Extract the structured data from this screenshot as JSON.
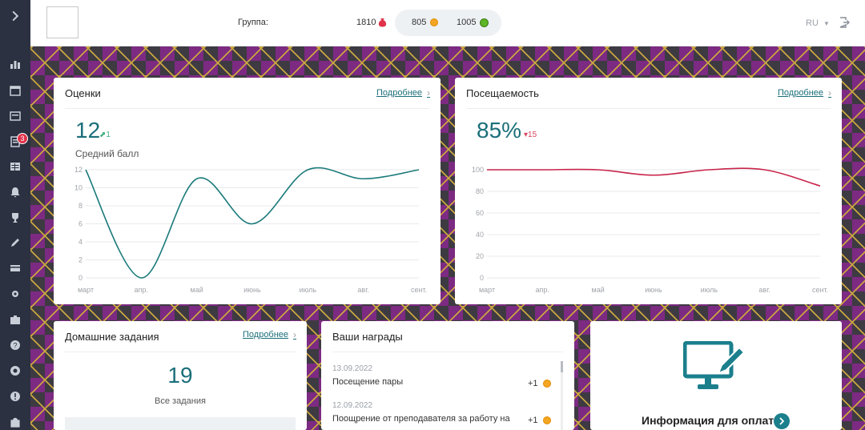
{
  "header": {
    "group_label": "Группа:",
    "money": "1810",
    "coins_orange": "805",
    "coins_green": "1005",
    "language": "RU"
  },
  "sidebar": {
    "badge_count": "3",
    "items": [
      "chart-icon",
      "calendar-icon",
      "book-icon",
      "homework-icon",
      "schedule-icon",
      "bell-icon",
      "trophy-icon",
      "pen-icon",
      "card-icon",
      "settings-icon",
      "briefcase-icon",
      "help-icon",
      "support-icon",
      "warning-icon",
      "shop-icon"
    ]
  },
  "grades": {
    "title": "Оценки",
    "details": "Подробнее",
    "value": "12",
    "delta": "1",
    "subtitle": "Средний балл"
  },
  "attendance": {
    "title": "Посещаемость",
    "details": "Подробнее",
    "value": "85%",
    "delta": "15"
  },
  "homework": {
    "title": "Домашние задания",
    "details": "Подробнее",
    "value": "19",
    "subtitle": "Все задания"
  },
  "awards": {
    "title": "Ваши награды",
    "items": [
      {
        "date": "13.09.2022",
        "text": "Посещение пары",
        "amount": "+1"
      },
      {
        "date": "12.09.2022",
        "text": "Поощрение от преподавателя за работу на",
        "amount": "+1"
      }
    ]
  },
  "payment": {
    "title": "Информация для оплаты"
  },
  "colors": {
    "accent": "#1b6f7a",
    "grades_line": "#1b7a7a",
    "attendance_line": "#c8244a",
    "sidebar": "#2b3140"
  },
  "chart_data": [
    {
      "type": "line",
      "categories": [
        "март",
        "апр.",
        "май",
        "июнь",
        "июль",
        "авг.",
        "сент."
      ],
      "series": [
        {
          "values": [
            12,
            0,
            11,
            6,
            12,
            11,
            12
          ]
        }
      ],
      "yticks": [
        0,
        2,
        4,
        6,
        8,
        10,
        12
      ],
      "ylim": [
        0,
        12
      ],
      "grid": true
    },
    {
      "type": "line",
      "categories": [
        "март",
        "апр.",
        "май",
        "июнь",
        "июль",
        "авг.",
        "сент."
      ],
      "series": [
        {
          "values": [
            100,
            100,
            100,
            95,
            100,
            100,
            85
          ]
        }
      ],
      "yticks": [
        0,
        20,
        40,
        60,
        80,
        100
      ],
      "ylim": [
        0,
        100
      ],
      "grid": true
    }
  ]
}
